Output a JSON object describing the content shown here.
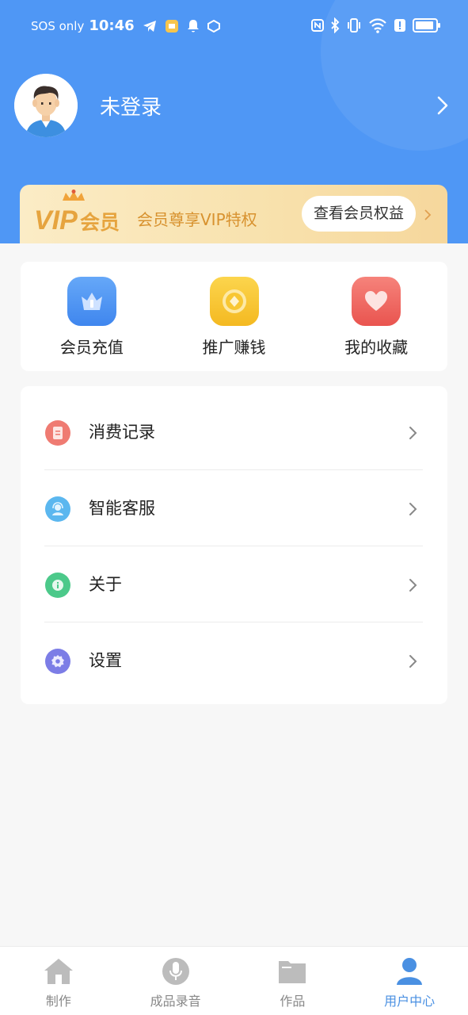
{
  "statusbar": {
    "carrier": "SOS only",
    "time": "10:46"
  },
  "profile": {
    "login_status": "未登录"
  },
  "vip": {
    "logo_text": "VIP会员",
    "tagline": "会员尊享VIP特权",
    "button_label": "查看会员权益"
  },
  "quick_actions": [
    {
      "label": "会员充值",
      "icon": "crown-icon",
      "color": "#4f97f5"
    },
    {
      "label": "推广赚钱",
      "icon": "coin-icon",
      "color": "#f7c53a"
    },
    {
      "label": "我的收藏",
      "icon": "heart-icon",
      "color": "#ef6e6b"
    }
  ],
  "menu": [
    {
      "label": "消费记录",
      "icon": "receipt-icon",
      "color": "#ef7b72"
    },
    {
      "label": "智能客服",
      "icon": "customer-service-icon",
      "color": "#5bb7ef"
    },
    {
      "label": "关于",
      "icon": "info-icon",
      "color": "#4cc98a"
    },
    {
      "label": "设置",
      "icon": "settings-gear-icon",
      "color": "#7c7de6"
    }
  ],
  "tabbar": [
    {
      "label": "制作",
      "icon": "home-icon",
      "active": false
    },
    {
      "label": "成品录音",
      "icon": "microphone-icon",
      "active": false
    },
    {
      "label": "作品",
      "icon": "folder-icon",
      "active": false
    },
    {
      "label": "用户中心",
      "icon": "user-icon",
      "active": true
    }
  ],
  "colors": {
    "header_bg": "#4f97f5",
    "accent": "#4a90e2",
    "vip_gold": "#d8922f"
  }
}
